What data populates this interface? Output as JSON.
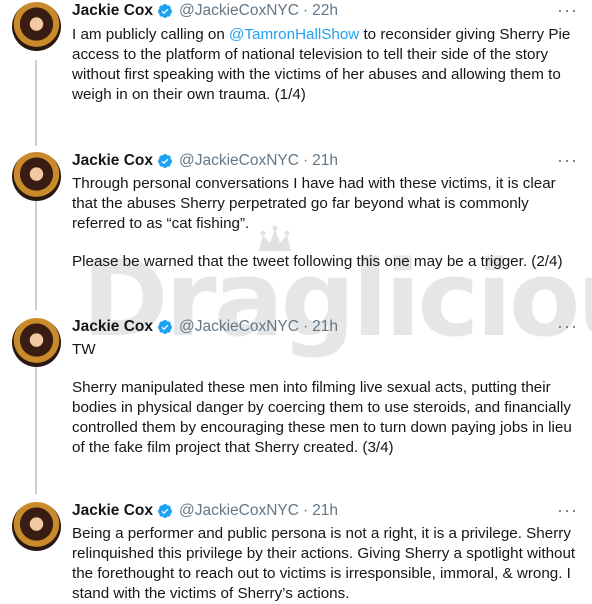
{
  "tweets": [
    {
      "name": "Jackie Cox",
      "handle": "@JackieCoxNYC",
      "time": "22h",
      "before_mention": "I am publicly calling on ",
      "mention": "@TamronHallShow",
      "after_mention": " to reconsider giving Sherry Pie access to the platform of national television to tell their side of the story without first speaking with the victims of her abuses and allowing them to weigh in on their own trauma. (1/4)"
    },
    {
      "name": "Jackie Cox",
      "handle": "@JackieCoxNYC",
      "time": "21h",
      "paragraph1": "Through personal conversations I have had with these victims, it is clear that the abuses Sherry perpetrated go far beyond what is commonly referred to as “cat fishing”.",
      "paragraph2": "Please be warned that the tweet following this one may be a trigger. (2/4)"
    },
    {
      "name": "Jackie Cox",
      "handle": "@JackieCoxNYC",
      "time": "21h",
      "paragraph1": "TW",
      "paragraph2": "Sherry manipulated these men into filming live sexual acts, putting their bodies in physical danger by coercing them to use steroids, and financially controlled them by encouraging these men to turn down paying jobs in lieu of the fake film project that Sherry created. (3/4)"
    },
    {
      "name": "Jackie Cox",
      "handle": "@JackieCoxNYC",
      "time": "21h",
      "paragraph1": "Being a performer and public persona is not a right, it is a privilege. Sherry relinquished this privilege by their actions. Giving Sherry a spotlight without the forethought to reach out to victims is irresponsible, immoral, & wrong. I stand with the victims of Sherry’s actions."
    }
  ],
  "separator": "·",
  "more_icon": "more-horizontal-icon",
  "verified_icon": "verified-badge-icon",
  "watermark": "Draglicious",
  "colors": {
    "link": "#1da1f2",
    "muted": "#657786",
    "text": "#14171a",
    "thread": "#c4cfd6"
  }
}
